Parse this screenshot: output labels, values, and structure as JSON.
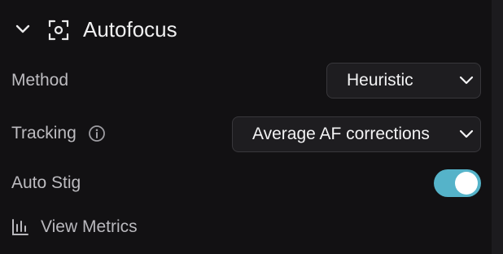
{
  "section": {
    "title": "Autofocus",
    "expanded": true,
    "icons": {
      "toggle": "chevron-down-icon",
      "section": "focus-target-icon"
    }
  },
  "method": {
    "label": "Method",
    "value": "Heuristic"
  },
  "tracking": {
    "label": "Tracking",
    "value": "Average AF corrections",
    "info_icon": "info-icon"
  },
  "auto_stig": {
    "label": "Auto Stig",
    "enabled": true
  },
  "metrics": {
    "label": "View Metrics",
    "icon": "bar-chart-icon"
  },
  "colors": {
    "background": "#121113",
    "control_bg": "#1e1d20",
    "accent": "#55b3c9",
    "label_text": "#bdbcc0"
  }
}
